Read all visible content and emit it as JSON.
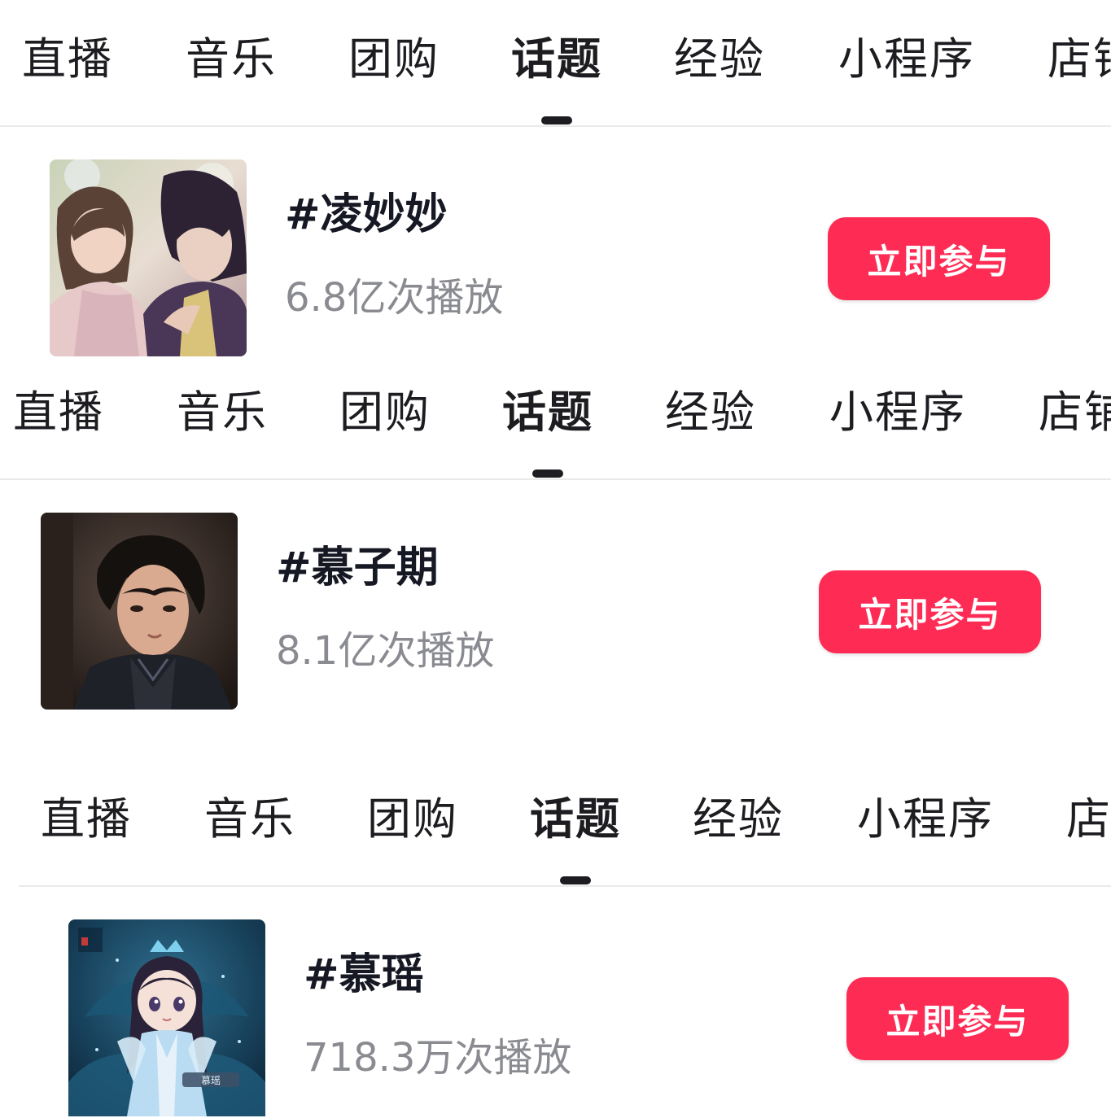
{
  "accent_color": "#fe2c55",
  "tabs": [
    {
      "label": "直播",
      "active": false
    },
    {
      "label": "音乐",
      "active": false
    },
    {
      "label": "团购",
      "active": false
    },
    {
      "label": "话题",
      "active": true
    },
    {
      "label": "经验",
      "active": false
    },
    {
      "label": "小程序",
      "active": false
    },
    {
      "label": "店铺",
      "active": false
    }
  ],
  "topics": [
    {
      "title": "#凌妙妙",
      "plays": "6.8亿次播放",
      "join_label": "立即参与",
      "thumbnail": "anime-couple-illustration"
    },
    {
      "title": "#慕子期",
      "plays": "8.1亿次播放",
      "join_label": "立即参与",
      "thumbnail": "actor-portrait"
    },
    {
      "title": "#慕瑶",
      "plays": "718.3万次播放",
      "join_label": "立即参与",
      "thumbnail": "chibi-character-card",
      "thumbnail_caption": "慕瑶"
    }
  ]
}
